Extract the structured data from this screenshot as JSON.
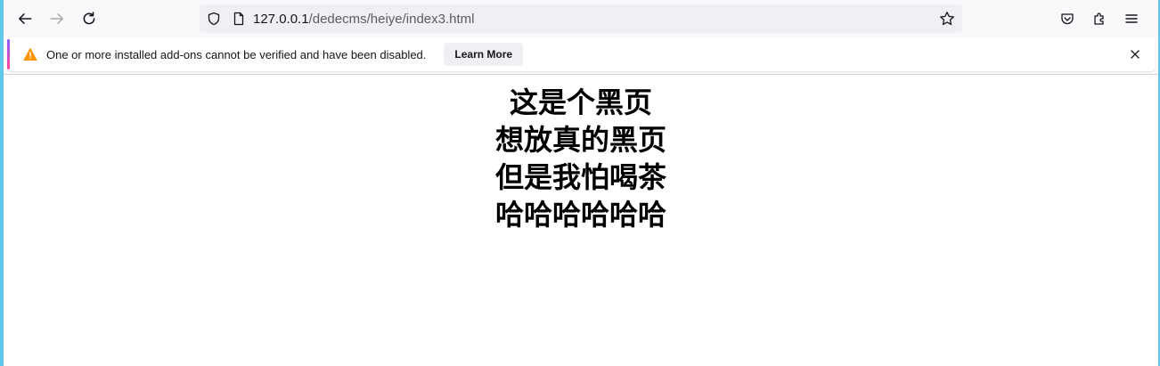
{
  "browser": {
    "url_host": "127.0.0.1",
    "url_path": "/dedecms/heiye/index3.html"
  },
  "toolbar": {
    "back_icon": "arrow-left-icon",
    "forward_icon": "arrow-right-icon",
    "reload_icon": "reload-icon",
    "shield_icon": "shield-icon",
    "page_icon": "page-icon",
    "bookmark_icon": "star-icon",
    "pocket_icon": "pocket-icon",
    "extensions_icon": "puzzle-icon",
    "menu_icon": "hamburger-menu-icon"
  },
  "notification": {
    "message": "One or more installed add-ons cannot be verified and have been disabled.",
    "button_label": "Learn More",
    "icon": "warning-icon",
    "close_icon": "close-icon",
    "accent_color": "#ff9400"
  },
  "page": {
    "lines": [
      "这是个黑页",
      "想放真的黑页",
      "但是我怕喝茶",
      "哈哈哈哈哈哈"
    ]
  }
}
